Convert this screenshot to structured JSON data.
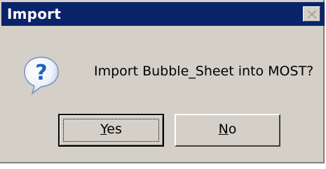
{
  "window": {
    "title": "Import"
  },
  "dialog": {
    "icon": "question-icon",
    "message": "Import Bubble_Sheet into MOST?"
  },
  "buttons": {
    "yes": {
      "accel": "Y",
      "rest": "es"
    },
    "no": {
      "accel": "N",
      "rest": "o"
    }
  },
  "colors": {
    "titlebar": "#0a246a",
    "window_bg": "#d4d0c8",
    "icon_blue": "#1f5fc2"
  }
}
